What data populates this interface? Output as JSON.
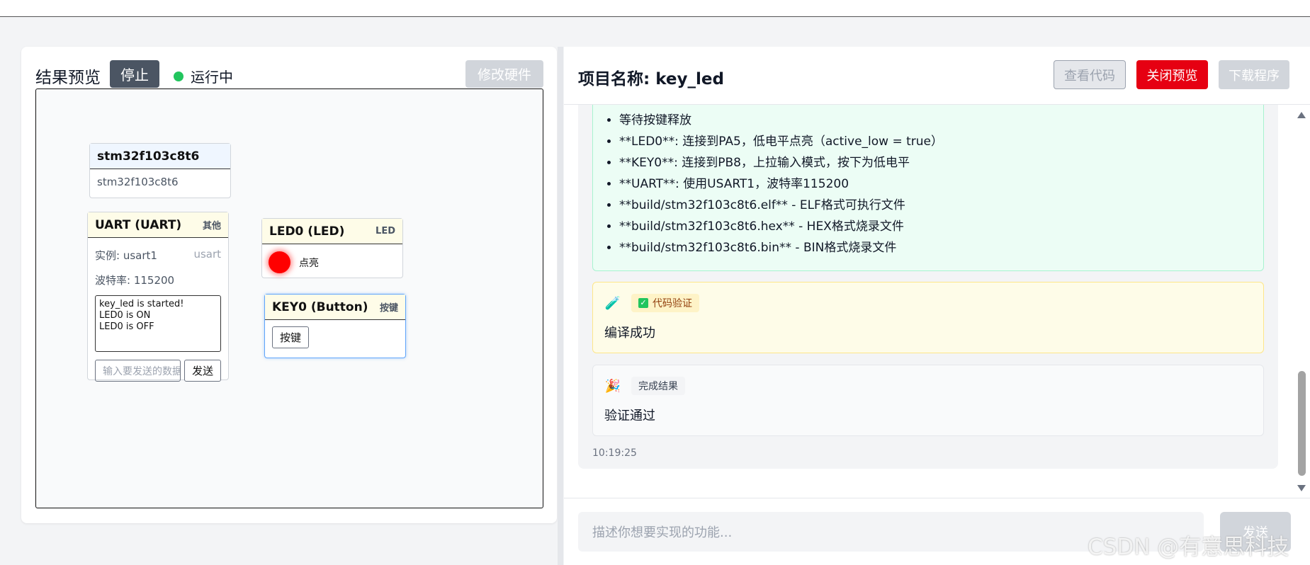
{
  "left": {
    "title": "结果预览",
    "stop_label": "停止",
    "status_label": "运行中",
    "modify_label": "修改硬件",
    "mcu": {
      "title": "stm32f103c8t6",
      "subtitle": "stm32f103c8t6"
    },
    "uart": {
      "title": "UART (UART)",
      "tag": "其他",
      "instance_label": "实例: usart1",
      "instance_tag": "usart",
      "baud_label": "波特率: 115200",
      "log_lines": [
        "key_led is started!",
        "LED0 is ON",
        "LED0 is OFF"
      ],
      "input_placeholder": "输入要发送的数据",
      "send_label": "发送"
    },
    "led": {
      "title": "LED0 (LED)",
      "tag": "LED",
      "state_label": "点亮",
      "color": "#ff0000"
    },
    "key": {
      "title": "KEY0 (Button)",
      "tag": "按键",
      "button_label": "按键"
    }
  },
  "right": {
    "title": "项目名称: key_led",
    "view_code_label": "查看代码",
    "close_preview_label": "关闭预览",
    "download_label": "下载程序",
    "list_items": [
      "等待按键释放",
      "**LED0**: 连接到PA5，低电平点亮（active_low = true）",
      "**KEY0**: 连接到PB8，上拉输入模式，按下为低电平",
      "**UART**: 使用USART1，波特率115200",
      "**build/stm32f103c8t6.elf** - ELF格式可执行文件",
      "**build/stm32f103c8t6.hex** - HEX格式烧录文件",
      "**build/stm32f103c8t6.bin** - BIN格式烧录文件"
    ],
    "verify": {
      "icon": "test-tube-icon",
      "chip": "代码验证",
      "text": "编译成功"
    },
    "done": {
      "icon": "party-popper-icon",
      "chip": "完成结果",
      "text": "验证通过"
    },
    "time": "10:19:25",
    "input_placeholder": "描述你想要实现的功能...",
    "send_label": "发送"
  },
  "watermark": "CSDN @有意思科技",
  "colors": {
    "accent_red": "#e60012",
    "status_green": "#22c55e",
    "stop_gray": "#4b5563"
  }
}
